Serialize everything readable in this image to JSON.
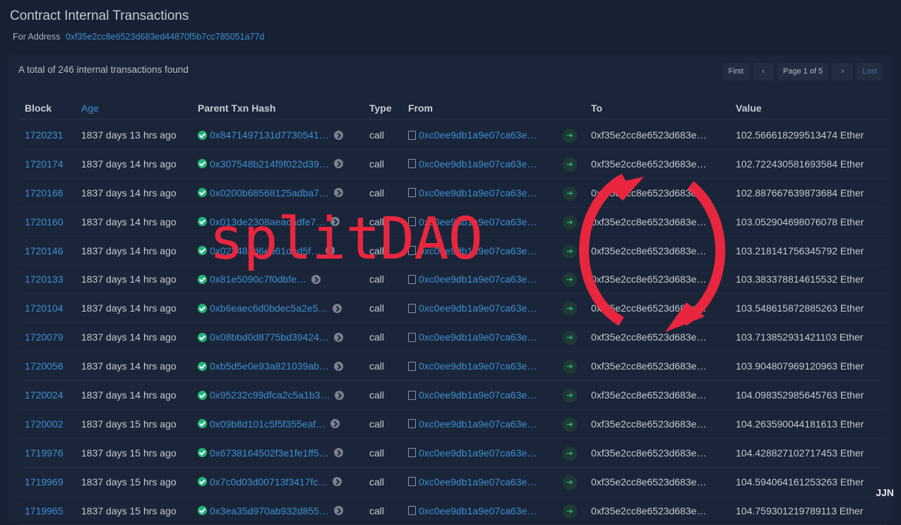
{
  "page": {
    "title": "Contract Internal Transactions",
    "subtitle_label": "For Address",
    "address": "0xf35e2cc8e6523d683ed44870f5b7cc785051a77d",
    "total_text": "A total of 246 internal transactions found"
  },
  "pager": {
    "first": "First",
    "prev": "‹",
    "page": "Page 1 of 5",
    "next": "›",
    "last": "Last"
  },
  "table": {
    "headers": {
      "block": "Block",
      "age": "Age",
      "hash": "Parent Txn Hash",
      "type": "Type",
      "from": "From",
      "to": "To",
      "value": "Value"
    },
    "rows": [
      {
        "block": "1720231",
        "age": "1837 days 13 hrs ago",
        "hash": "0x8471497131d7730541…",
        "type": "call",
        "from": "0xc0ee9db1a9e07ca63e…",
        "to": "0xf35e2cc8e6523d683e…",
        "value": "102.566618299513474 Ether"
      },
      {
        "block": "1720174",
        "age": "1837 days 14 hrs ago",
        "hash": "0x307548b214f9f022d39…",
        "type": "call",
        "from": "0xc0ee9db1a9e07ca63e…",
        "to": "0xf35e2cc8e6523d683e…",
        "value": "102.722430581693584 Ether"
      },
      {
        "block": "1720166",
        "age": "1837 days 14 hrs ago",
        "hash": "0x0200b68568125adba7…",
        "type": "call",
        "from": "0xc0ee9db1a9e07ca63e…",
        "to": "0xf35e2cc8e6523d683e…",
        "value": "102.887667639873684 Ether"
      },
      {
        "block": "1720160",
        "age": "1837 days 14 hrs ago",
        "hash": "0x013de2308aeacadfe7…",
        "type": "call",
        "from": "0xc0ee9db1a9e07ca63e…",
        "to": "0xf35e2cc8e6523d683e…",
        "value": "103.052904698076078 Ether"
      },
      {
        "block": "1720146",
        "age": "1837 days 14 hrs ago",
        "hash": "0x022482d6eb61dad5f…",
        "type": "call",
        "from": "0xc0ee9db1a9e07ca63e…",
        "to": "0xf35e2cc8e6523d683e…",
        "value": "103.218141756345792 Ether"
      },
      {
        "block": "1720133",
        "age": "1837 days 14 hrs ago",
        "hash": "0x81e5090c7f0dbfe…",
        "type": "call",
        "from": "0xc0ee9db1a9e07ca63e…",
        "to": "0xf35e2cc8e6523d683e…",
        "value": "103.383378814615532 Ether"
      },
      {
        "block": "1720104",
        "age": "1837 days 14 hrs ago",
        "hash": "0xb6eaec6d0bdec5a2e5…",
        "type": "call",
        "from": "0xc0ee9db1a9e07ca63e…",
        "to": "0xf35e2cc8e6523d683e…",
        "value": "103.548615872885263 Ether"
      },
      {
        "block": "1720079",
        "age": "1837 days 14 hrs ago",
        "hash": "0x08bbd0d8775bd39424…",
        "type": "call",
        "from": "0xc0ee9db1a9e07ca63e…",
        "to": "0xf35e2cc8e6523d683e…",
        "value": "103.713852931421103 Ether"
      },
      {
        "block": "1720056",
        "age": "1837 days 14 hrs ago",
        "hash": "0xb5d5e0e93a821039ab…",
        "type": "call",
        "from": "0xc0ee9db1a9e07ca63e…",
        "to": "0xf35e2cc8e6523d683e…",
        "value": "103.904807969120963 Ether"
      },
      {
        "block": "1720024",
        "age": "1837 days 14 hrs ago",
        "hash": "0x95232c99dfca2c5a1b3…",
        "type": "call",
        "from": "0xc0ee9db1a9e07ca63e…",
        "to": "0xf35e2cc8e6523d683e…",
        "value": "104.098352985645763 Ether"
      },
      {
        "block": "1720002",
        "age": "1837 days 15 hrs ago",
        "hash": "0x09b8d101c5f5f355eaf…",
        "type": "call",
        "from": "0xc0ee9db1a9e07ca63e…",
        "to": "0xf35e2cc8e6523d683e…",
        "value": "104.263590044181613 Ether"
      },
      {
        "block": "1719976",
        "age": "1837 days 15 hrs ago",
        "hash": "0x6738164502f3e1fe1ff5…",
        "type": "call",
        "from": "0xc0ee9db1a9e07ca63e…",
        "to": "0xf35e2cc8e6523d683e…",
        "value": "104.428827102717453 Ether"
      },
      {
        "block": "1719969",
        "age": "1837 days 15 hrs ago",
        "hash": "0x7c0d03d00713f3417fc…",
        "type": "call",
        "from": "0xc0ee9db1a9e07ca63e…",
        "to": "0xf35e2cc8e6523d683e…",
        "value": "104.594064161253263 Ether"
      },
      {
        "block": "1719965",
        "age": "1837 days 15 hrs ago",
        "hash": "0x3ea35d970ab932d855…",
        "type": "call",
        "from": "0xc0ee9db1a9e07ca63e…",
        "to": "0xf35e2cc8e6523d683e…",
        "value": "104.759301219789113 Ether"
      }
    ]
  },
  "overlay": {
    "text": "splitDAO",
    "color": "#e8273e",
    "icon": "refresh-cycle-arrows-icon"
  },
  "watermark": "JJN",
  "colors": {
    "background": "#182134",
    "link": "#3b8fd0",
    "success": "#23b477"
  }
}
